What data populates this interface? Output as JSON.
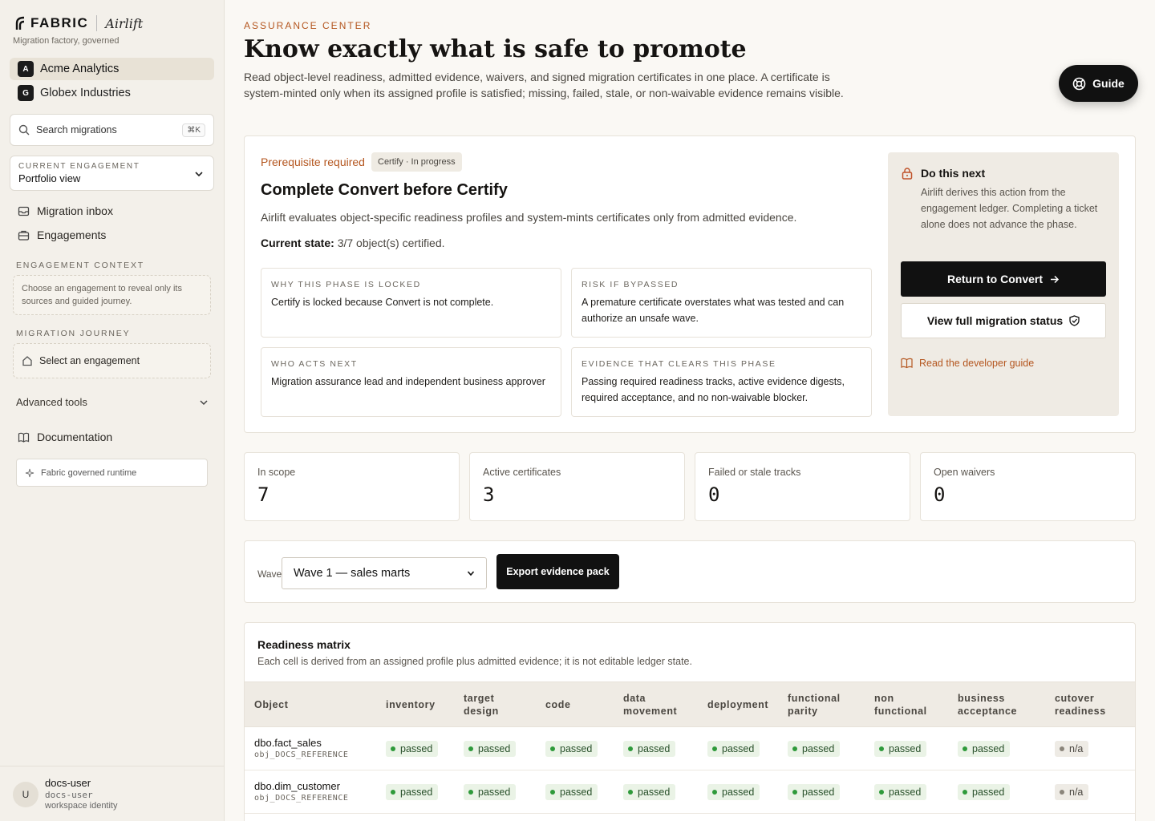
{
  "brand": {
    "logo_text": "FABRIC",
    "product": "Airlift",
    "tagline": "Migration factory, governed"
  },
  "tenants": [
    {
      "badge": "A",
      "name": "Acme Analytics",
      "active": true
    },
    {
      "badge": "G",
      "name": "Globex Industries",
      "active": false
    }
  ],
  "search": {
    "placeholder": "Search migrations",
    "shortcut": "⌘K"
  },
  "engagement": {
    "label": "CURRENT ENGAGEMENT",
    "value": "Portfolio view"
  },
  "nav": {
    "inbox": "Migration inbox",
    "engagements": "Engagements",
    "documentation": "Documentation"
  },
  "context": {
    "label": "ENGAGEMENT CONTEXT",
    "text": "Choose an engagement to reveal only its sources and guided journey."
  },
  "journey": {
    "label": "MIGRATION JOURNEY",
    "item": "Select an engagement"
  },
  "advanced": "Advanced tools",
  "runtime": "Fabric governed runtime",
  "user": {
    "initial": "U",
    "name": "docs-user",
    "handle": "docs-user",
    "role": "workspace identity"
  },
  "header": {
    "eyebrow": "ASSURANCE CENTER",
    "title": "Know exactly what is safe to promote",
    "description": "Read object-level readiness, admitted evidence, waivers, and signed migration certificates in one place. A certificate is system-minted only when its assigned profile is satisfied; missing, failed, stale, or non-waivable evidence remains visible.",
    "guide": "Guide"
  },
  "phase": {
    "prereq": "Prerequisite required",
    "status": "Certify · In progress",
    "title": "Complete Convert before Certify",
    "description": "Airlift evaluates object-specific readiness profiles and system-mints certificates only from admitted evidence.",
    "current_state_label": "Current state:",
    "current_state_value": "3/7 object(s) certified.",
    "boxes": [
      {
        "title": "WHY THIS PHASE IS LOCKED",
        "text": "Certify is locked because Convert is not complete."
      },
      {
        "title": "RISK IF BYPASSED",
        "text": "A premature certificate overstates what was tested and can authorize an unsafe wave."
      },
      {
        "title": "WHO ACTS NEXT",
        "text": "Migration assurance lead and independent business approver"
      },
      {
        "title": "EVIDENCE THAT CLEARS THIS PHASE",
        "text": "Passing required readiness tracks, active evidence digests, required acceptance, and no non-waivable blocker."
      }
    ],
    "next": {
      "title": "Do this next",
      "text": "Airlift derives this action from the engagement ledger. Completing a ticket alone does not advance the phase.",
      "primary": "Return to Convert",
      "secondary": "View full migration status",
      "link": "Read the developer guide"
    }
  },
  "stats": [
    {
      "label": "In scope",
      "value": "7"
    },
    {
      "label": "Active certificates",
      "value": "3"
    },
    {
      "label": "Failed or stale tracks",
      "value": "0"
    },
    {
      "label": "Open waivers",
      "value": "0"
    }
  ],
  "filter": {
    "wave_label": "Wave",
    "wave_value": "Wave 1 — sales marts",
    "export": "Export evidence pack"
  },
  "matrix": {
    "title": "Readiness matrix",
    "subtitle": "Each cell is derived from an assigned profile plus admitted evidence; it is not editable ledger state.",
    "columns": [
      [
        "Object"
      ],
      [
        "inventory"
      ],
      [
        "target",
        "design"
      ],
      [
        "code"
      ],
      [
        "data",
        "movement"
      ],
      [
        "deployment"
      ],
      [
        "functional",
        "parity"
      ],
      [
        "non",
        "functional"
      ],
      [
        "business",
        "acceptance"
      ],
      [
        "cutover",
        "readiness"
      ]
    ],
    "rows": [
      {
        "name": "dbo.fact_sales",
        "ref": "obj_DOCS_REFERENCE",
        "cells": [
          "passed",
          "passed",
          "passed",
          "passed",
          "passed",
          "passed",
          "passed",
          "passed",
          "n/a"
        ]
      },
      {
        "name": "dbo.dim_customer",
        "ref": "obj_DOCS_REFERENCE",
        "cells": [
          "passed",
          "passed",
          "passed",
          "passed",
          "passed",
          "passed",
          "passed",
          "passed",
          "n/a"
        ]
      }
    ]
  }
}
